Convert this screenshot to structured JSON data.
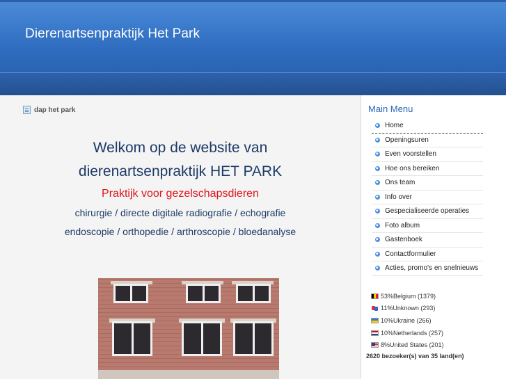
{
  "header": {
    "site_title": "Dierenartsenpraktijk Het Park"
  },
  "breadcrumb": {
    "icon": "document-icon",
    "label": "dap het park"
  },
  "welcome": {
    "line1": "Welkom op de website van",
    "line2": "dierenartsenpraktijk HET PARK",
    "line3": "Praktijk voor gezelschapsdieren",
    "line4": "chirurgie / directe digitale radiografie / echografie",
    "line5": "endoscopie / orthopedie / arthroscopie / bloedanalyse"
  },
  "sidebar": {
    "title": "Main Menu",
    "items": [
      {
        "label": "Home"
      },
      {
        "label": "Openingsuren"
      },
      {
        "label": "Even voorstellen"
      },
      {
        "label": "Hoe ons bereiken"
      },
      {
        "label": "Ons team"
      },
      {
        "label": "Info over"
      },
      {
        "label": "Gespecialiseerde operaties"
      },
      {
        "label": "Foto album"
      },
      {
        "label": "Gastenboek"
      },
      {
        "label": "Contactformulier"
      },
      {
        "label": "Acties, promo's en snelnieuws"
      }
    ]
  },
  "stats": {
    "rows": [
      {
        "flag": "belgium-flag-icon",
        "text": "53%Belgium (1379)"
      },
      {
        "flag": "unknown-flag-icon",
        "text": "11%Unknown (293)"
      },
      {
        "flag": "ukraine-flag-icon",
        "text": "10%Ukraine (266)"
      },
      {
        "flag": "netherlands-flag-icon",
        "text": "10%Netherlands (257)"
      },
      {
        "flag": "us-flag-icon",
        "text": "8%United States (201)"
      }
    ],
    "total": "2620 bezoeker(s) van 35 land(en)"
  },
  "colors": {
    "header_blue": "#3f7fcf",
    "title_red": "#e0141b",
    "text_navy": "#1d3a66",
    "menu_title_blue": "#2b67b6"
  }
}
